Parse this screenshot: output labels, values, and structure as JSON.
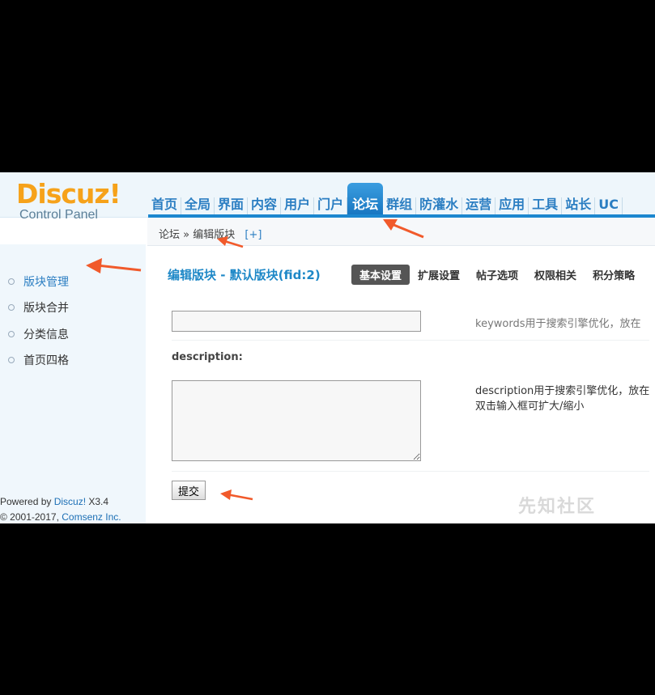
{
  "logo": {
    "name": "Discuz!",
    "sub": "Control Panel"
  },
  "nav": [
    "首页",
    "全局",
    "界面",
    "内容",
    "用户",
    "门户",
    "论坛",
    "群组",
    "防灌水",
    "运营",
    "应用",
    "工具",
    "站长",
    "UC"
  ],
  "nav_active_index": 6,
  "breadcrumb": {
    "root": "论坛",
    "separator": "»",
    "current": "编辑版块",
    "add": "[+]"
  },
  "sidebar": {
    "items": [
      "版块管理",
      "版块合并",
      "分类信息",
      "首页四格"
    ],
    "active_index": 0
  },
  "footer": {
    "powered_prefix": "Powered by ",
    "brand": "Discuz!",
    "version": " X3.4",
    "copyright_prefix": "© 2001-2017, ",
    "company": "Comsenz Inc."
  },
  "page": {
    "title": "编辑版块 - 默认版块(fid:2)",
    "tabs": [
      "基本设置",
      "扩展设置",
      "帖子选项",
      "权限相关",
      "积分策略"
    ],
    "active_tab_index": 0
  },
  "form": {
    "keywords_value": "",
    "keywords_hint": "keywords用于搜索引擎优化，放在",
    "description_label": "description:",
    "description_value": "",
    "description_hint_line1": "description用于搜索引擎优化，放在",
    "description_hint_line2": "双击输入框可扩大/缩小",
    "submit_label": "提交"
  },
  "watermark": "先知社区",
  "accent_color": "#1c87cf",
  "arrow_color": "#f15a2b"
}
